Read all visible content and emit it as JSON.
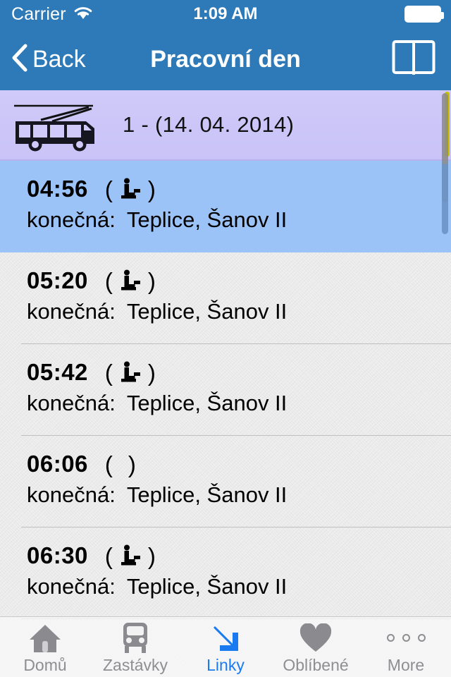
{
  "status_bar": {
    "carrier": "Carrier",
    "wifi_icon": "wifi-icon",
    "time": "1:09 AM",
    "battery_icon": "battery-full-icon"
  },
  "nav_bar": {
    "back_label": "Back",
    "back_icon": "chevron-left-icon",
    "title": "Pracovní den",
    "right_action_icon": "open-book-icon"
  },
  "route_header": {
    "vehicle_icon": "trolleybus-icon",
    "label": "1 - (14. 04. 2014)"
  },
  "departures": {
    "line2_label": "konečná:",
    "paren_open": "(",
    "paren_close": ")",
    "accessible_icon": "wheelchair-accessible-icon",
    "rows": [
      {
        "time": "04:56",
        "accessible": true,
        "destination": "Teplice, Šanov II",
        "selected": true
      },
      {
        "time": "05:20",
        "accessible": true,
        "destination": "Teplice, Šanov II",
        "selected": false
      },
      {
        "time": "05:42",
        "accessible": true,
        "destination": "Teplice, Šanov II",
        "selected": false
      },
      {
        "time": "06:06",
        "accessible": false,
        "destination": "Teplice, Šanov II",
        "selected": false
      },
      {
        "time": "06:30",
        "accessible": true,
        "destination": "Teplice, Šanov II",
        "selected": false
      }
    ]
  },
  "tab_bar": {
    "items": [
      {
        "label": "Domů",
        "icon": "home-icon",
        "active": false
      },
      {
        "label": "Zastávky",
        "icon": "bus-stop-icon",
        "active": false
      },
      {
        "label": "Linky",
        "icon": "arrow-down-right-icon",
        "active": true
      },
      {
        "label": "Oblíbené",
        "icon": "heart-icon",
        "active": false
      },
      {
        "label": "More",
        "icon": "ellipsis-icon",
        "active": false
      }
    ]
  },
  "colors": {
    "nav_blue": "#2e7ab8",
    "selected_row": "#9cc3f8",
    "route_band": "#c9c3f7",
    "accent": "#1a7bf0",
    "tab_inactive": "#8e8e93"
  }
}
